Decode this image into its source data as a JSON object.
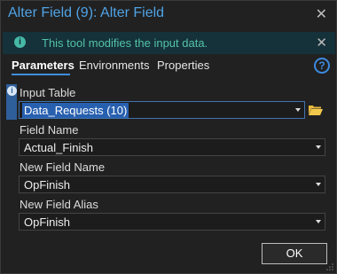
{
  "window": {
    "title": "Alter Field (9): Alter Field",
    "close_glyph": "✕"
  },
  "message": {
    "text": "This tool modifies the input data.",
    "info_glyph": "i",
    "close_glyph": "✕"
  },
  "tabs": [
    {
      "label": "Parameters",
      "active": true
    },
    {
      "label": "Environments",
      "active": false
    },
    {
      "label": "Properties",
      "active": false
    }
  ],
  "help_glyph": "?",
  "params": {
    "input_table": {
      "label": "Input Table",
      "value": "Data_Requests (10)",
      "info_glyph": "i"
    },
    "field_name": {
      "label": "Field Name",
      "value": "Actual_Finish"
    },
    "new_field_name": {
      "label": "New Field Name",
      "value": "OpFinish"
    },
    "new_field_alias": {
      "label": "New Field Alias",
      "value": "OpFinish"
    }
  },
  "buttons": {
    "ok_label": "OK"
  },
  "colors": {
    "accent": "#4fa3e6",
    "message_bg": "#15313a",
    "message_text": "#53c3a6",
    "selection": "#2860b0",
    "folder": "#e6b93f"
  }
}
